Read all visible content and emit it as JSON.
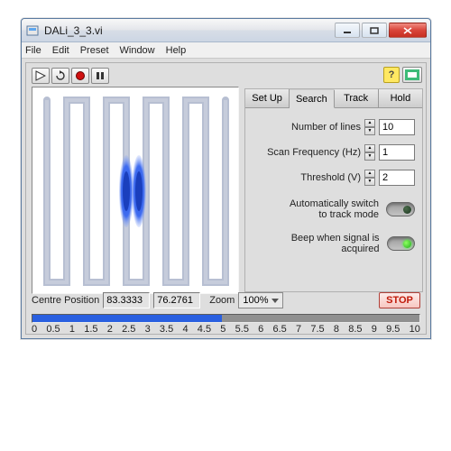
{
  "window": {
    "title": "DALi_3_3.vi"
  },
  "menu": {
    "file": "File",
    "edit": "Edit",
    "preset": "Preset",
    "window": "Window",
    "help": "Help"
  },
  "toolbar": {
    "run": "▶",
    "loop": "↻",
    "record": "●",
    "pause": "❚❚"
  },
  "help_badge": "?",
  "tabs": {
    "setup": "Set Up",
    "search": "Search",
    "track": "Track",
    "hold": "Hold",
    "active": "search"
  },
  "search_panel": {
    "num_lines_label": "Number of lines",
    "num_lines_value": "10",
    "scan_freq_label": "Scan Frequency (Hz)",
    "scan_freq_value": "1",
    "threshold_label": "Threshold (V)",
    "threshold_value": "2",
    "auto_switch_label": "Automatically switch\nto track mode",
    "auto_switch_on": false,
    "beep_label": "Beep when signal is acquired",
    "beep_on": true
  },
  "status": {
    "centre_label": "Centre Position",
    "centre_x": "83.3333",
    "centre_y": "76.2761",
    "zoom_label": "Zoom",
    "zoom_value": "100%",
    "stop_label": "STOP",
    "progress_percent": 49
  },
  "ruler": [
    "0",
    "0.5",
    "1",
    "1.5",
    "2",
    "2.5",
    "3",
    "3.5",
    "4",
    "4.5",
    "5",
    "5.5",
    "6",
    "6.5",
    "7",
    "7.5",
    "8",
    "8.5",
    "9",
    "9.5",
    "10"
  ],
  "colors": {
    "accent_blue": "#2b58df",
    "stop_red": "#c01a0a",
    "led_on": "#3cff2c"
  }
}
